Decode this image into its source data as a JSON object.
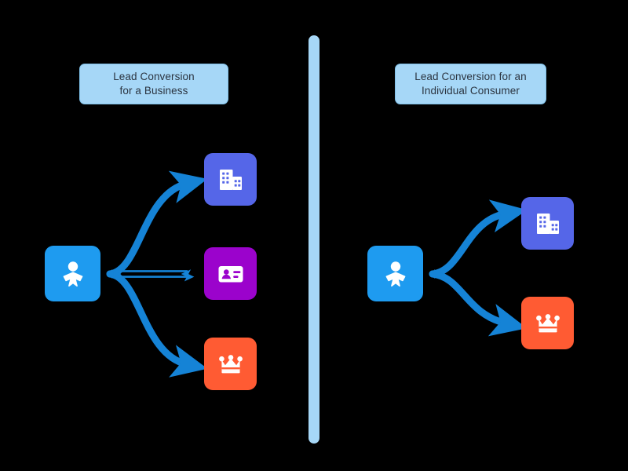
{
  "diagram": {
    "title_left": "Lead Conversion\nfor a Business",
    "title_right": "Lead Conversion for an\nIndividual Consumer",
    "background_color": "#000000",
    "divider": {
      "name": "vertical-divider",
      "color": "#A6D7F7"
    },
    "colors": {
      "label_fill": "#A6D7F7",
      "label_text": "#2B3440",
      "lead_tile": "#1E9BF0",
      "building_tile": "#5566E8",
      "card_tile": "#9B03CC",
      "crown_tile": "#FF5B33",
      "arrow": "#1583D6"
    },
    "left_group": {
      "source": {
        "icon": "person-lead-icon",
        "color": "#1E9BF0"
      },
      "targets": [
        {
          "icon": "building-account-icon",
          "color": "#5566E8"
        },
        {
          "icon": "contact-card-icon",
          "color": "#9B03CC"
        },
        {
          "icon": "crown-opportunity-icon",
          "color": "#FF5B33"
        }
      ]
    },
    "right_group": {
      "source": {
        "icon": "person-lead-icon",
        "color": "#1E9BF0"
      },
      "targets": [
        {
          "icon": "building-account-icon",
          "color": "#5566E8"
        },
        {
          "icon": "crown-opportunity-icon",
          "color": "#FF5B33"
        }
      ]
    }
  }
}
